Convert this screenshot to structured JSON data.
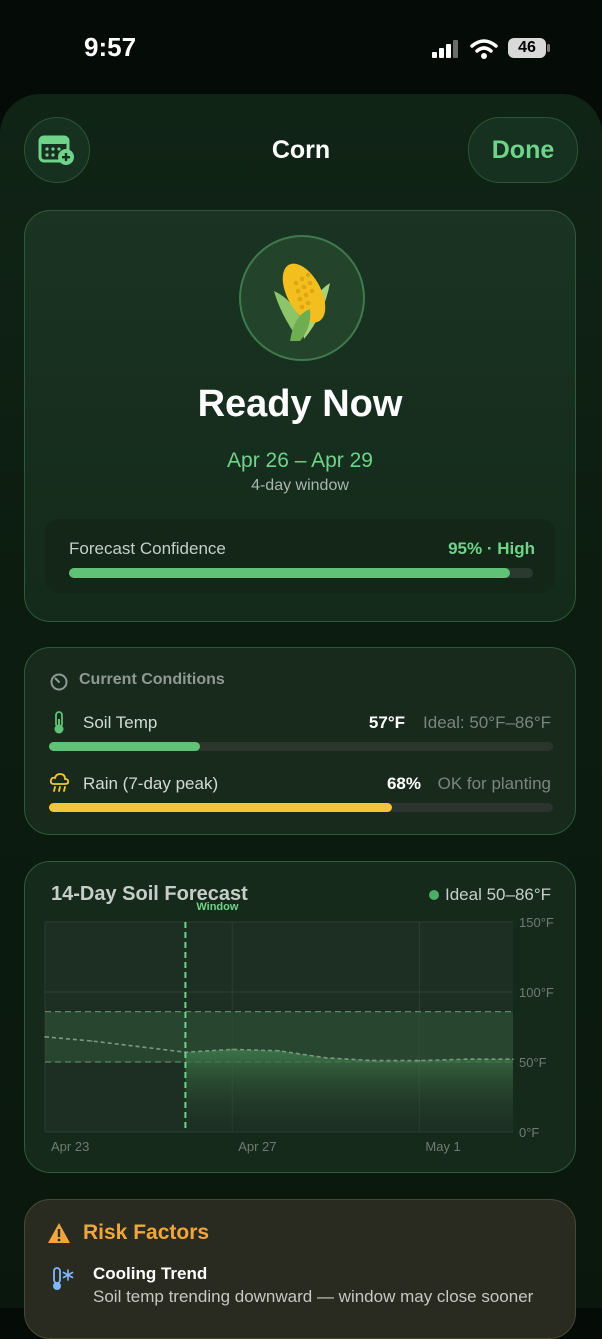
{
  "status_bar": {
    "time": "9:57",
    "battery": "46"
  },
  "header": {
    "title": "Corn",
    "done_label": "Done"
  },
  "hero": {
    "status": "Ready Now",
    "date_range": "Apr 26 – Apr 29",
    "window_length": "4-day window",
    "confidence_label": "Forecast Confidence",
    "confidence_value": "95% · High",
    "confidence_fraction": 0.95
  },
  "conditions": {
    "heading": "Current Conditions",
    "rows": [
      {
        "label": "Soil Temp",
        "value": "57°F",
        "note": "Ideal: 50°F–86°F",
        "fraction": 0.3,
        "color": "#5fc277"
      },
      {
        "label": "Rain (7-day peak)",
        "value": "68%",
        "note": "OK for planting",
        "fraction": 0.68,
        "color": "#f2c53a"
      }
    ]
  },
  "forecast": {
    "title": "14-Day Soil Forecast",
    "legend": "Ideal 50–86°F",
    "window_label": "Window",
    "chart_data": {
      "type": "line",
      "y_unit": "°F",
      "ylim": [
        0,
        150
      ],
      "y_ticks": [
        "150°F",
        "100°F",
        "50°F",
        "0°F"
      ],
      "x_tick_labels": [
        "Apr 23",
        "Apr 27",
        "May 1"
      ],
      "ideal_band": [
        50,
        86
      ],
      "window_start": "Apr 26",
      "series": [
        {
          "x": [
            "Apr 23",
            "Apr 24",
            "Apr 25",
            "Apr 26",
            "Apr 27",
            "Apr 28",
            "Apr 29",
            "Apr 30",
            "May 1",
            "May 2",
            "May 3"
          ],
          "values": [
            68,
            65,
            61,
            57,
            59,
            58,
            53,
            51,
            51,
            52,
            52
          ]
        }
      ]
    }
  },
  "risks": {
    "title": "Risk Factors",
    "items": [
      {
        "title": "Cooling Trend",
        "description": "Soil temp trending downward — window may close sooner"
      }
    ]
  },
  "colors": {
    "accent": "#6fd389",
    "warning": "#f0a63c",
    "rain": "#f2c53a"
  }
}
